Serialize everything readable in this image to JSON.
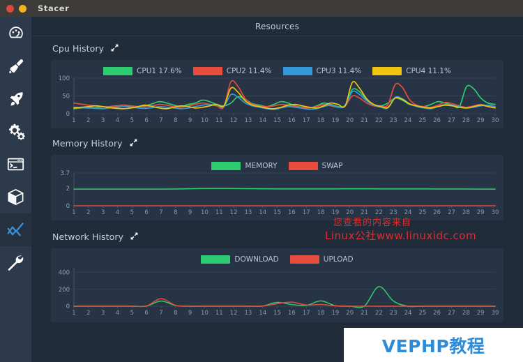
{
  "window": {
    "title": "Stacer",
    "controls": {
      "close": "close-button",
      "minimize": "minimize-button"
    }
  },
  "sidebar": {
    "items": [
      {
        "name": "dashboard",
        "icon": "gauge-icon",
        "active": false
      },
      {
        "name": "system-cleaner",
        "icon": "brush-icon",
        "active": false
      },
      {
        "name": "startup-apps",
        "icon": "rocket-icon",
        "active": false
      },
      {
        "name": "services",
        "icon": "gears-icon",
        "active": false
      },
      {
        "name": "processes",
        "icon": "terminal-icon",
        "active": false
      },
      {
        "name": "uninstaller",
        "icon": "package-icon",
        "active": false
      },
      {
        "name": "resources",
        "icon": "line-chart-icon",
        "active": true
      },
      {
        "name": "tools",
        "icon": "wrench-icon",
        "active": false
      }
    ]
  },
  "header": {
    "title": "Resources"
  },
  "sections": {
    "cpu": {
      "title": "Cpu History",
      "expand_icon": "expand-arrows-icon"
    },
    "memory": {
      "title": "Memory History",
      "expand_icon": "expand-arrows-icon"
    },
    "network": {
      "title": "Network History",
      "expand_icon": "expand-arrows-icon"
    }
  },
  "colors": {
    "green": "#2ecc71",
    "red": "#e74c3c",
    "blue": "#3498db",
    "yellow": "#f1c40f",
    "panel": "#273445",
    "background": "#212c3a",
    "sidebar": "#2c3a4b",
    "sidebar_active": "#253140",
    "titlebar": "#3c3b37",
    "accent_blue": "#2e8bd8",
    "watermark_red": "#e02c2c"
  },
  "legends": {
    "cpu": [
      {
        "label": "CPU1 17.6%",
        "color": "#2ecc71"
      },
      {
        "label": "CPU2 11.4%",
        "color": "#e74c3c"
      },
      {
        "label": "CPU3 11.4%",
        "color": "#3498db"
      },
      {
        "label": "CPU4 11.1%",
        "color": "#f1c40f"
      }
    ],
    "memory": [
      {
        "label": "MEMORY",
        "color": "#2ecc71"
      },
      {
        "label": "SWAP",
        "color": "#e74c3c"
      }
    ],
    "network": [
      {
        "label": "DOWNLOAD",
        "color": "#2ecc71"
      },
      {
        "label": "UPLOAD",
        "color": "#e74c3c"
      }
    ]
  },
  "watermarks": {
    "chinese": "您查看的内容来自",
    "url": "Linux公社www.linuxidc.com",
    "banner": "VEPHP教程"
  },
  "chart_data": [
    {
      "id": "cpu-history-chart",
      "type": "line",
      "title": "Cpu History",
      "xlabel": "",
      "ylabel": "",
      "ylim": [
        0,
        100
      ],
      "yticks": [
        0,
        50,
        100
      ],
      "xticks": [
        1,
        2,
        3,
        4,
        5,
        6,
        7,
        8,
        9,
        10,
        11,
        12,
        13,
        14,
        15,
        16,
        17,
        18,
        19,
        20,
        21,
        22,
        23,
        24,
        25,
        26,
        27,
        28,
        29,
        30
      ],
      "grid": true,
      "legend_position": "top",
      "series": [
        {
          "name": "CPU1 17.6%",
          "color": "#2ecc71",
          "values": [
            14,
            16,
            18,
            17,
            19,
            20,
            22,
            24,
            20,
            18,
            22,
            28,
            34,
            30,
            24,
            20,
            26,
            30,
            38,
            34,
            26,
            22,
            30,
            48,
            40,
            28,
            24,
            20,
            26,
            34,
            30,
            22,
            18,
            16,
            22,
            30,
            26,
            20,
            24,
            68,
            62,
            40,
            26,
            22,
            30,
            44,
            38,
            26,
            22,
            20,
            26,
            34,
            30,
            24,
            20,
            76,
            70,
            44,
            30,
            26
          ]
        },
        {
          "name": "CPU2 11.4%",
          "color": "#e74c3c",
          "values": [
            30,
            27,
            24,
            22,
            20,
            19,
            21,
            24,
            22,
            20,
            19,
            22,
            26,
            24,
            20,
            18,
            22,
            26,
            30,
            26,
            22,
            19,
            90,
            76,
            42,
            26,
            22,
            20,
            22,
            26,
            24,
            20,
            18,
            17,
            20,
            26,
            22,
            18,
            22,
            50,
            44,
            30,
            22,
            20,
            26,
            82,
            74,
            40,
            24,
            20,
            18,
            24,
            32,
            28,
            22,
            18,
            22,
            26,
            22,
            18
          ]
        },
        {
          "name": "CPU3 11.4%",
          "color": "#3498db",
          "values": [
            18,
            17,
            16,
            15,
            14,
            16,
            18,
            20,
            18,
            16,
            15,
            17,
            20,
            18,
            16,
            14,
            16,
            20,
            24,
            26,
            24,
            20,
            54,
            46,
            30,
            22,
            18,
            14,
            12,
            16,
            20,
            18,
            15,
            12,
            14,
            20,
            24,
            18,
            22,
            62,
            54,
            36,
            24,
            18,
            16,
            46,
            42,
            28,
            20,
            16,
            14,
            20,
            26,
            24,
            20,
            16,
            18,
            22,
            24,
            20
          ]
        },
        {
          "name": "CPU4 11.1%",
          "color": "#f1c40f",
          "values": [
            16,
            18,
            20,
            22,
            20,
            17,
            15,
            14,
            16,
            20,
            24,
            20,
            16,
            14,
            18,
            22,
            20,
            16,
            18,
            22,
            26,
            22,
            72,
            60,
            36,
            24,
            20,
            16,
            14,
            18,
            24,
            26,
            22,
            18,
            16,
            22,
            30,
            26,
            22,
            88,
            72,
            42,
            26,
            20,
            18,
            44,
            40,
            28,
            22,
            18,
            16,
            20,
            24,
            22,
            18,
            16,
            20,
            24,
            20,
            16
          ]
        }
      ]
    },
    {
      "id": "memory-history-chart",
      "type": "line",
      "title": "Memory History",
      "xlabel": "",
      "ylabel": "",
      "ylim": [
        0,
        3.7
      ],
      "yticks": [
        0,
        2,
        3.7
      ],
      "xticks": [
        1,
        2,
        3,
        4,
        5,
        6,
        7,
        8,
        9,
        10,
        11,
        12,
        13,
        14,
        15,
        16,
        17,
        18,
        19,
        20,
        21,
        22,
        23,
        24,
        25,
        26,
        27,
        28,
        29,
        30
      ],
      "grid": true,
      "legend_position": "top",
      "series": [
        {
          "name": "MEMORY",
          "color": "#2ecc71",
          "values": [
            1.88,
            1.88,
            1.88,
            1.88,
            1.88,
            1.88,
            1.88,
            1.89,
            1.92,
            1.95,
            1.96,
            1.95,
            1.93,
            1.91,
            1.9,
            1.9,
            1.9,
            1.9,
            1.9,
            1.91,
            1.91,
            1.9,
            1.9,
            1.9,
            1.9,
            1.89,
            1.89,
            1.89,
            1.88,
            1.88
          ]
        },
        {
          "name": "SWAP",
          "color": "#e74c3c",
          "values": [
            0,
            0,
            0,
            0,
            0,
            0,
            0,
            0,
            0,
            0,
            0,
            0,
            0,
            0,
            0,
            0,
            0,
            0,
            0,
            0,
            0,
            0,
            0,
            0,
            0,
            0,
            0,
            0,
            0,
            0
          ]
        }
      ]
    },
    {
      "id": "network-history-chart",
      "type": "line",
      "title": "Network History",
      "xlabel": "",
      "ylabel": "",
      "ylim": [
        0,
        450
      ],
      "yticks": [
        0,
        200,
        400
      ],
      "xticks": [
        1,
        2,
        3,
        4,
        5,
        6,
        7,
        8,
        9,
        10,
        11,
        12,
        13,
        14,
        15,
        16,
        17,
        18,
        19,
        20,
        21,
        22,
        23,
        24,
        25,
        26,
        27,
        28,
        29,
        30
      ],
      "grid": true,
      "legend_position": "top",
      "series": [
        {
          "name": "DOWNLOAD",
          "color": "#2ecc71",
          "values": [
            0,
            0,
            0,
            0,
            0,
            2,
            60,
            8,
            0,
            0,
            0,
            0,
            0,
            2,
            45,
            20,
            10,
            62,
            6,
            0,
            2,
            230,
            60,
            0,
            0,
            0,
            0,
            0,
            0,
            0
          ]
        },
        {
          "name": "UPLOAD",
          "color": "#e74c3c",
          "values": [
            0,
            0,
            0,
            0,
            0,
            3,
            88,
            10,
            0,
            0,
            0,
            0,
            0,
            2,
            30,
            48,
            14,
            20,
            4,
            0,
            0,
            0,
            0,
            0,
            0,
            0,
            0,
            0,
            0,
            0
          ]
        }
      ]
    }
  ]
}
